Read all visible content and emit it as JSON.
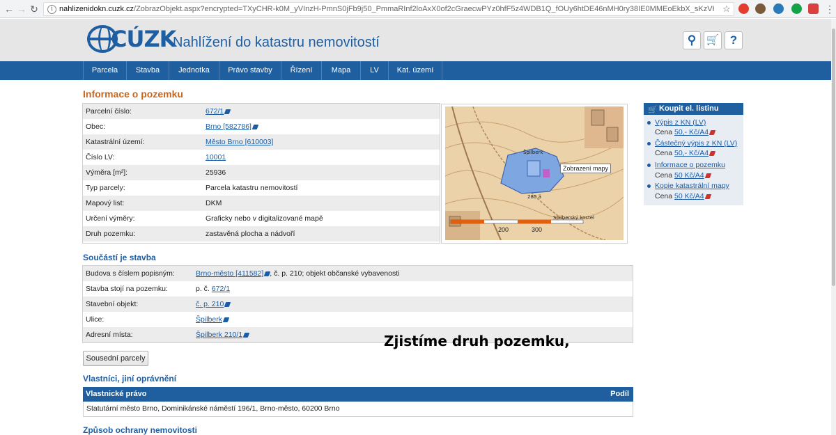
{
  "browser": {
    "url_host": "nahlizenidokn.cuzk.cz",
    "url_path": "/ZobrazObjekt.aspx?encrypted=TXyCHR-k0M_yVInzH-PmnS0jFb9j50_PmmaRInf2loAxX0of2cGraecwPYz0hfF5z4WDB1Q_fOUy6htDE46nMH0ry38IE0MMEoEkbX_sKzVHuyh..."
  },
  "header": {
    "logo_text": "CÚZK",
    "title": "Nahlížení do katastru nemovitostí"
  },
  "nav": [
    "Parcela",
    "Stavba",
    "Jednotka",
    "Právo stavby",
    "Řízení",
    "Mapa",
    "LV",
    "Kat. území"
  ],
  "parcel": {
    "heading": "Informace o pozemku",
    "rows": [
      {
        "label": "Parcelní číslo:",
        "value": "672/1"
      },
      {
        "label": "Obec:",
        "value": "Brno [582786]"
      },
      {
        "label": "Katastrální území:",
        "value": "Město Brno [610003]"
      },
      {
        "label": "Číslo LV:",
        "value": "10001"
      },
      {
        "label": "Výměra [m²]:",
        "value": "25936"
      },
      {
        "label": "Typ parcely:",
        "value": "Parcela katastru nemovitostí"
      },
      {
        "label": "Mapový list:",
        "value": "DKM"
      },
      {
        "label": "Určení výměry:",
        "value": "Graficky nebo v digitalizované mapě"
      },
      {
        "label": "Druh pozemku:",
        "value": "zastavěná plocha a nádvoří"
      }
    ]
  },
  "map": {
    "tooltip": "Zobrazení mapy",
    "scale_labels": [
      "200",
      "300"
    ],
    "label_building": "Špilberk",
    "label_castle": "Spilberský kostel",
    "label_hill": "280 ä"
  },
  "sidebar": {
    "title": "Koupit el. listinu",
    "items": [
      {
        "label": "Výpis z KN (LV)",
        "price_prefix": "Cena ",
        "price": "50,- Kč/A4"
      },
      {
        "label": "Částečný výpis z KN (LV)",
        "price_prefix": "Cena ",
        "price": "50,- Kč/A4"
      },
      {
        "label": "Informace o pozemku",
        "price_prefix": "Cena ",
        "price": "50 Kč/A4"
      },
      {
        "label": "Kopie katastrální mapy",
        "price_prefix": "Cena ",
        "price": "50 Kč/A4"
      }
    ]
  },
  "building": {
    "heading": "Součástí je stavba",
    "rows": [
      {
        "label": "Budova s číslem popisným:",
        "link": "Brno-město [411582]",
        "suffix": ", č. p. 210; objekt občanské vybavenosti"
      },
      {
        "label": "Stavba stojí na pozemku:",
        "prefix": "p. č. ",
        "link": "672/1"
      },
      {
        "label": "Stavební objekt:",
        "link": "č. p. 210"
      },
      {
        "label": "Ulice:",
        "link": "Špilberk"
      },
      {
        "label": "Adresní místa:",
        "link": "Špilberk 210/1"
      }
    ]
  },
  "neighbors_button": "Sousední parcely",
  "owners": {
    "heading": "Vlastníci, jiní oprávnění",
    "col_right": "Vlastnické právo",
    "col_share": "Podíl",
    "row": "Statutární město Brno, Dominikánské náměstí 196/1, Brno-město, 60200 Brno"
  },
  "protection_heading": "Způsob ochrany nemovitosti",
  "subtitle": "Zjistíme druh pozemku,",
  "colors": {
    "brand_blue": "#1f5e9f",
    "heading_orange": "#c8651b",
    "link": "#1a5da6"
  }
}
